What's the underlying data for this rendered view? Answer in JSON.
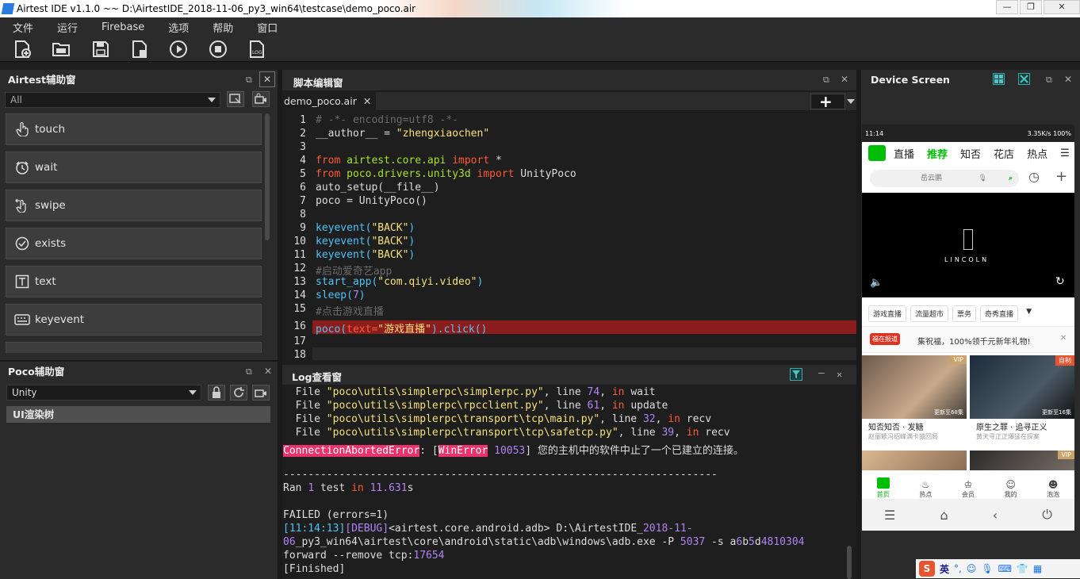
{
  "window": {
    "title": "Airtest IDE v1.1.0 ~~ D:\\AirtestIDE_2018-11-06_py3_win64\\testcase\\demo_poco.air"
  },
  "menu": [
    "文件",
    "运行",
    "Firebase",
    "选项",
    "帮助",
    "窗口"
  ],
  "airtest_panel": {
    "title": "Airtest辅助窗",
    "filter_value": "All",
    "commands": [
      "touch",
      "wait",
      "swipe",
      "exists",
      "text",
      "keyevent"
    ]
  },
  "poco_panel": {
    "title": "Poco辅助窗",
    "mode_value": "Unity",
    "tree_item": "UI渲染树"
  },
  "editor": {
    "title": "脚本编辑窗",
    "tab_label": "demo_poco.air",
    "line_numbers": [
      "1",
      "2",
      "3",
      "4",
      "5",
      "6",
      "7",
      "8",
      "9",
      "10",
      "11",
      "12",
      "13",
      "14",
      "15",
      "16",
      "17",
      "18"
    ],
    "lines": {
      "l1": "# -*- encoding=utf8 -*-",
      "l2a": "__author__ = ",
      "l2b": "\"zhengxiaochen\"",
      "l4a": "from",
      "l4b": " airtest.core.api ",
      "l4c": "import",
      "l4d": " *",
      "l5a": "from",
      "l5b": " poco.drivers.unity3d ",
      "l5c": "import",
      "l5d": " UnityPoco",
      "l6": "auto_setup(__file__)",
      "l7": "poco = UnityPoco()",
      "l9a": "keyevent(",
      "l9b": "\"BACK\"",
      "l9c": ")",
      "l10a": "keyevent(",
      "l10b": "\"BACK\"",
      "l10c": ")",
      "l11a": "keyevent(",
      "l11b": "\"BACK\"",
      "l11c": ")",
      "l12": "#启动爱奇艺app",
      "l13a": "start_app(",
      "l13b": "\"com.qiyi.video\"",
      "l13c": ")",
      "l14a": "sleep(",
      "l14b": "7",
      "l14c": ")",
      "l15": "#点击游戏直播",
      "l16a": "poco(",
      "l16b": "text=",
      "l16c": "\"游戏直播\"",
      "l16d": ").click()"
    }
  },
  "log": {
    "title": "Log查看窗",
    "l1a": "  File ",
    "l1b": "\"poco\\utils\\simplerpc\\simplerpc.py\"",
    "l1c": ", line ",
    "l1d": "74",
    "l1e": ", ",
    "l1f": "in",
    "l1g": " wait",
    "l2b": "\"poco\\utils\\simplerpc\\rpcclient.py\"",
    "l2d": "61",
    "l2g": " update",
    "l3b": "\"poco\\utils\\simplerpc\\transport\\tcp\\main.py\"",
    "l3d": "32",
    "l3g": " recv",
    "l4b": "\"poco\\utils\\simplerpc\\transport\\tcp\\safetcp.py\"",
    "l4d": "39",
    "l4g": " recv",
    "err_a": "ConnectionAbortedError",
    "err_b": ": [",
    "err_c": "WinError",
    "err_d": " 10053",
    "err_e": "] 您的主机中的软件中止了一个已建立的连接。",
    "sep": "----------------------------------------------------------------------",
    "ran_a": "Ran ",
    "ran_b": "1",
    "ran_c": " test ",
    "ran_d": "in",
    "ran_e": " 11.631",
    "ran_f": "s",
    "failed": "FAILED (errors=1)",
    "dbg_a": "[11:14:13]",
    "dbg_b": "[DEBUG]",
    "dbg_c": "<airtest.core.android.adb> D:\\AirtestIDE_",
    "dbg_d": "2018-11-",
    "dbg2_a": "06",
    "dbg2_b": "_py3_win64\\airtest\\core\\android\\static\\adb\\windows\\adb.exe -P ",
    "dbg2_c": "5037",
    "dbg2_d": " -s a",
    "dbg2_e": "6",
    "dbg2_f": "b",
    "dbg2_g": "5",
    "dbg2_h": "d",
    "dbg2_i": "4810304",
    "dbg3_a": "forward --remove tcp:",
    "dbg3_b": "17654",
    "finished": "[Finished]"
  },
  "device": {
    "title": "Device Screen",
    "status_time": "11:14",
    "status_right": "3.35K/s  100%",
    "nav_tabs": [
      "直播",
      "推荐",
      "知否",
      "花店",
      "热点"
    ],
    "search_placeholder": "岳云鹏",
    "video_brand": "LINCOLN",
    "chips": [
      "游戏直播",
      "流量超市",
      "票务",
      "奇秀直播"
    ],
    "promo_badge": "福在报道",
    "promo_text": "集祝福，100%领千元新年礼物!",
    "card1_title": "知否知否 · 发糖",
    "card1_sub": "赵丽颖冯绍峰满卡猿回局",
    "card1_tag": "VIP",
    "card1_overlay": "更新至68集",
    "card2_title": "原生之罪 · 追寻正义",
    "card2_sub": "黄天寻正正爆猛在探案",
    "card2_tag": "自制",
    "card2_overlay": "更新至16集",
    "card3_tag": "VIP",
    "bottom_nav": [
      "首页",
      "热点",
      "会员",
      "我的",
      "泡泡"
    ]
  },
  "taskbar": {
    "ime": "英"
  },
  "colors": {
    "accent": "#2a7be0",
    "highlight": "#8b1d1d",
    "error": "#e8336f",
    "brand_green": "#00be06"
  }
}
